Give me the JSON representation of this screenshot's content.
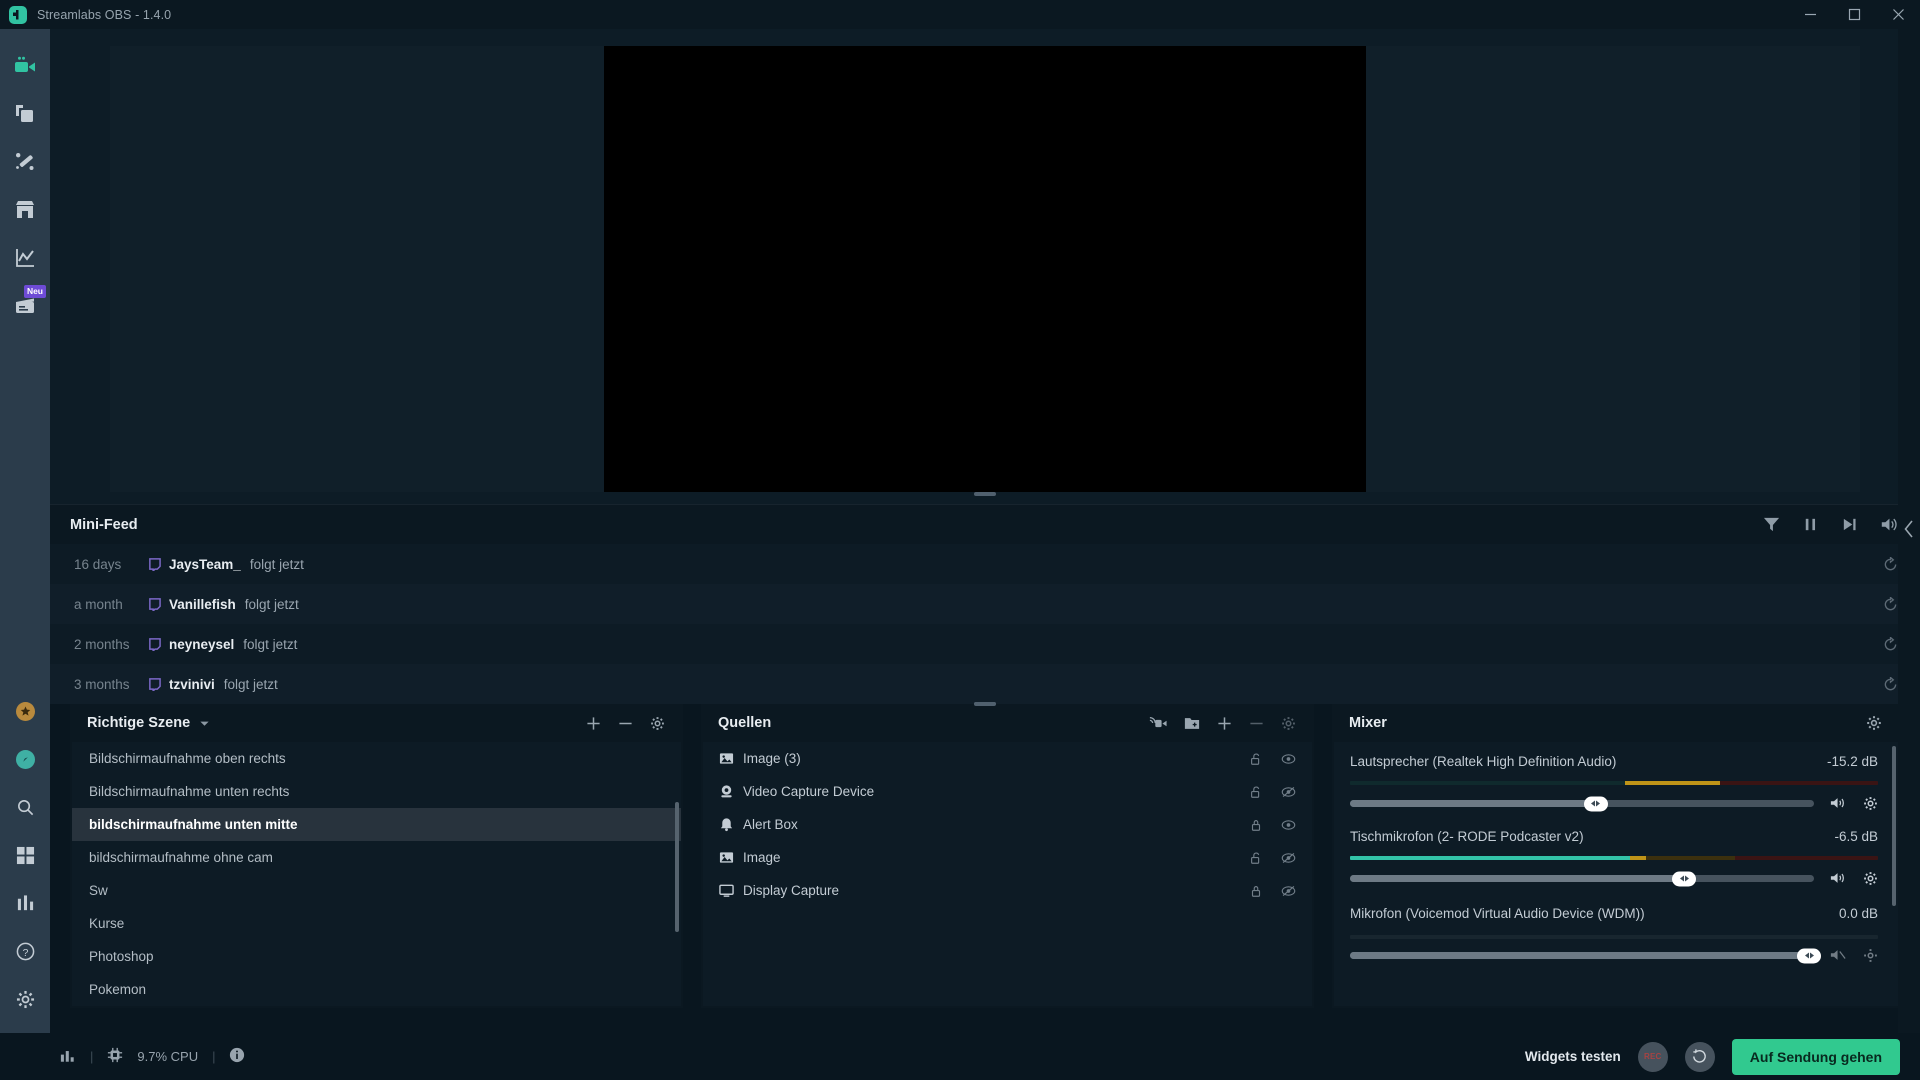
{
  "window": {
    "title": "Streamlabs OBS - 1.4.0",
    "minimize_label": "minimize",
    "maximize_label": "maximize",
    "close_label": "close"
  },
  "rail": {
    "items": [
      {
        "name": "editor",
        "icon": "video-camera-icon",
        "active": true,
        "badge": ""
      },
      {
        "name": "themes",
        "icon": "layers-icon",
        "active": false,
        "badge": ""
      },
      {
        "name": "alertbox",
        "icon": "magic-wand-icon",
        "active": false,
        "badge": ""
      },
      {
        "name": "store",
        "icon": "store-icon",
        "active": false,
        "badge": ""
      },
      {
        "name": "dashboard",
        "icon": "chart-line-icon",
        "active": false,
        "badge": ""
      },
      {
        "name": "editor-tools",
        "icon": "clapperboard-icon",
        "active": false,
        "badge": "Neu"
      }
    ],
    "bottom": [
      {
        "name": "prime",
        "icon": "prime-star-icon"
      },
      {
        "name": "help-compass",
        "icon": "compass-icon"
      },
      {
        "name": "search",
        "icon": "search-icon"
      },
      {
        "name": "apps",
        "icon": "grid-apps-icon"
      },
      {
        "name": "stats",
        "icon": "bars-icon"
      },
      {
        "name": "help",
        "icon": "question-circle-icon"
      },
      {
        "name": "settings",
        "icon": "gear-icon"
      }
    ]
  },
  "minifeed": {
    "title": "Mini-Feed",
    "tools": [
      {
        "name": "filter-icon",
        "label": "Filter"
      },
      {
        "name": "pause-icon",
        "label": "Pause"
      },
      {
        "name": "skip-icon",
        "label": "Skip"
      },
      {
        "name": "volume-icon",
        "label": "Volume"
      }
    ],
    "rows": [
      {
        "time": "16 days",
        "platform": "twitch-icon",
        "user": "JaysTeam_",
        "action": "folgt jetzt",
        "refresh": "replay-icon"
      },
      {
        "time": "a month",
        "platform": "twitch-icon",
        "user": "Vanillefish",
        "action": "folgt jetzt",
        "refresh": "replay-icon"
      },
      {
        "time": "2 months",
        "platform": "twitch-icon",
        "user": "neyneysel",
        "action": "folgt jetzt",
        "refresh": "replay-icon"
      },
      {
        "time": "3 months",
        "platform": "twitch-icon",
        "user": "tzvinivi",
        "action": "folgt jetzt",
        "refresh": "replay-icon"
      }
    ]
  },
  "scenes": {
    "title": "Richtige Szene",
    "tools": [
      {
        "name": "add-scene-icon",
        "label": "+"
      },
      {
        "name": "remove-scene-icon",
        "label": "−"
      },
      {
        "name": "scene-settings-icon",
        "label": "gear"
      }
    ],
    "items": [
      {
        "label": "Bildschirmaufnahme oben rechts",
        "selected": false
      },
      {
        "label": "Bildschirmaufnahme unten rechts",
        "selected": false
      },
      {
        "label": "bildschirmaufnahme unten mitte",
        "selected": true
      },
      {
        "label": "bildschirmaufnahme ohne cam",
        "selected": false
      },
      {
        "label": "Sw",
        "selected": false
      },
      {
        "label": "Kurse",
        "selected": false
      },
      {
        "label": "Photoshop",
        "selected": false
      },
      {
        "label": "Pokemon",
        "selected": false
      }
    ]
  },
  "sources": {
    "title": "Quellen",
    "tools": [
      {
        "name": "audio-source-icon",
        "label": "Audio"
      },
      {
        "name": "add-folder-icon",
        "label": "Add folder"
      },
      {
        "name": "add-source-icon",
        "label": "+"
      },
      {
        "name": "remove-source-icon",
        "label": "−"
      },
      {
        "name": "source-settings-icon",
        "label": "gear"
      }
    ],
    "items": [
      {
        "icon": "image-icon",
        "label": "Image (3)",
        "locked": false,
        "visible": true
      },
      {
        "icon": "webcam-icon",
        "label": "Video Capture Device",
        "locked": false,
        "visible": false
      },
      {
        "icon": "bell-icon",
        "label": "Alert Box",
        "locked": true,
        "visible": true
      },
      {
        "icon": "image-icon",
        "label": "Image",
        "locked": false,
        "visible": false
      },
      {
        "icon": "monitor-icon",
        "label": "Display Capture",
        "locked": true,
        "visible": false
      }
    ]
  },
  "mixer": {
    "title": "Mixer",
    "settings_icon": "gear-icon",
    "channels": [
      {
        "name": "Lautsprecher (Realtek High Definition Audio)",
        "db": "-15.2 dB",
        "meter": {
          "green_pct": 0,
          "green_dim_pct": 52,
          "yellow_pct": 18,
          "yellow_dim_pct": 0,
          "red_pct": 0,
          "red_dim_pct": 30
        },
        "volume_pct": 53,
        "muted": false
      },
      {
        "name": "Tischmikrofon (2- RODE Podcaster v2)",
        "db": "-6.5 dB",
        "meter": {
          "green_pct": 53,
          "green_dim_pct": 0,
          "yellow_pct": 3,
          "yellow_dim_pct": 17,
          "red_pct": 0,
          "red_dim_pct": 27
        },
        "volume_pct": 72,
        "muted": false
      },
      {
        "name": "Mikrofon (Voicemod Virtual Audio Device (WDM))",
        "db": "0.0 dB",
        "meter": {
          "green_pct": 0,
          "green_dim_pct": 0,
          "yellow_pct": 0,
          "yellow_dim_pct": 0,
          "red_pct": 0,
          "red_dim_pct": 0
        },
        "volume_pct": 100,
        "muted": true
      }
    ]
  },
  "statusbar": {
    "stats_icon": "bar-chart-icon",
    "cpu_icon": "cpu-chip-icon",
    "cpu": "9.7% CPU",
    "info_icon": "info-circle-icon",
    "separator": "|",
    "widgets_label": "Widgets testen",
    "rec_label": "REC",
    "replay_icon": "replay-buffer-icon",
    "go_live_label": "Auf Sendung gehen"
  },
  "right_panel": {
    "collapse_icon": "chevron-left-icon"
  },
  "colors": {
    "accent": "#31c98f",
    "rail_bg": "#2b3c4b",
    "panel_bg": "#0b1821",
    "app_bg": "#09161f",
    "selected_row": "#28333d",
    "twitch": "#7b68c7"
  }
}
